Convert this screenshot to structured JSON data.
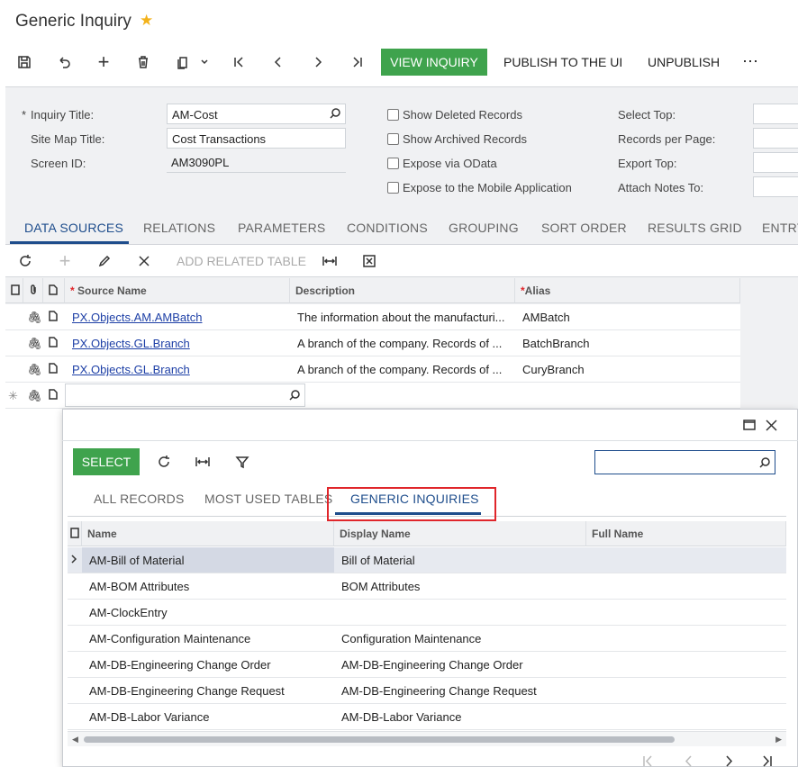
{
  "header": {
    "title": "Generic Inquiry"
  },
  "toolbar": {
    "view_inquiry": "VIEW INQUIRY",
    "publish": "PUBLISH TO THE UI",
    "unpublish": "UNPUBLISH",
    "more": "⋯"
  },
  "form": {
    "inquiry_title_label": "Inquiry Title:",
    "inquiry_title_value": "AM-Cost",
    "site_map_title_label": "Site Map Title:",
    "site_map_title_value": "Cost Transactions",
    "screen_id_label": "Screen ID:",
    "screen_id_value": "AM3090PL",
    "show_deleted": "Show Deleted Records",
    "show_archived": "Show Archived Records",
    "expose_odata": "Expose via OData",
    "expose_mobile": "Expose to the Mobile Application",
    "select_top": "Select Top:",
    "records_per_page": "Records per Page:",
    "export_top": "Export Top:",
    "attach_notes": "Attach Notes To:"
  },
  "tabs": [
    "DATA SOURCES",
    "RELATIONS",
    "PARAMETERS",
    "CONDITIONS",
    "GROUPING",
    "SORT ORDER",
    "RESULTS GRID",
    "ENTRY"
  ],
  "grid": {
    "add_related": "ADD RELATED TABLE",
    "columns": [
      "Source Name",
      "Description",
      "Alias"
    ],
    "rows": [
      {
        "source": "PX.Objects.AM.AMBatch",
        "description": "The information about the manufacturi...",
        "alias": "AMBatch"
      },
      {
        "source": "PX.Objects.GL.Branch",
        "description": "A branch of the company. Records of ...",
        "alias": "BatchBranch"
      },
      {
        "source": "PX.Objects.GL.Branch",
        "description": "A branch of the company. Records of ...",
        "alias": "CuryBranch"
      }
    ]
  },
  "dialog": {
    "select": "SELECT",
    "tabs": [
      "ALL RECORDS",
      "MOST USED TABLES",
      "GENERIC INQUIRIES"
    ],
    "columns": [
      "Name",
      "Display Name",
      "Full Name"
    ],
    "rows": [
      {
        "name": "AM-Bill of Material",
        "display": "Bill of Material"
      },
      {
        "name": "AM-BOM Attributes",
        "display": "BOM Attributes"
      },
      {
        "name": "AM-ClockEntry",
        "display": ""
      },
      {
        "name": "AM-Configuration Maintenance",
        "display": "Configuration Maintenance"
      },
      {
        "name": "AM-DB-Engineering Change Order",
        "display": "AM-DB-Engineering Change Order"
      },
      {
        "name": "AM-DB-Engineering Change Request",
        "display": "AM-DB-Engineering Change Request"
      },
      {
        "name": "AM-DB-Labor Variance",
        "display": "AM-DB-Labor Variance"
      }
    ]
  },
  "colors": {
    "accent_green": "#3fa34d",
    "link_blue": "#1d3fa6",
    "tab_active": "#1e4d8c",
    "highlight_red": "#e0262b"
  }
}
